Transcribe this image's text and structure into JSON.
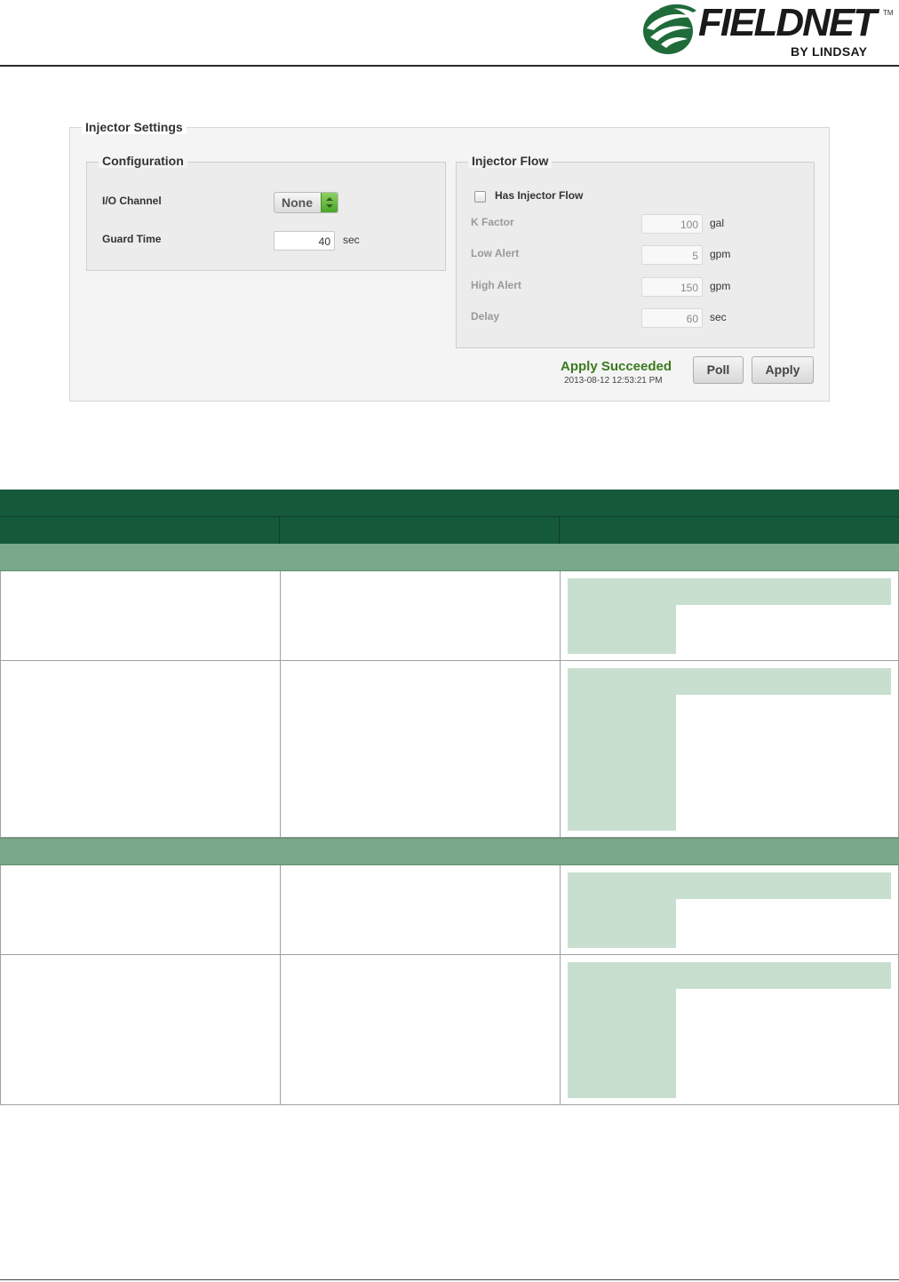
{
  "header": {
    "brand": "FIELDNET",
    "trademark": "TM",
    "sub_brand": "BY LINDSAY",
    "logo_colors": {
      "green": "#1f6b3a",
      "text": "#1a1a1a"
    }
  },
  "injector_settings": {
    "title": "Injector Settings",
    "configuration": {
      "title": "Configuration",
      "io_channel_label": "I/O Channel",
      "io_channel_value": "None",
      "guard_time_label": "Guard Time",
      "guard_time_value": "40",
      "guard_time_unit": "sec"
    },
    "injector_flow": {
      "title": "Injector Flow",
      "has_flow_label": "Has Injector Flow",
      "has_flow_checked": false,
      "fields": [
        {
          "label": "K Factor",
          "value": "100",
          "unit": "gal"
        },
        {
          "label": "Low Alert",
          "value": "5",
          "unit": "gpm"
        },
        {
          "label": "High Alert",
          "value": "150",
          "unit": "gpm"
        },
        {
          "label": "Delay",
          "value": "60",
          "unit": "sec"
        }
      ]
    },
    "status": {
      "message": "Apply Succeeded",
      "timestamp": "2013-08-12 12:53:21 PM"
    },
    "buttons": {
      "poll": "Poll",
      "apply": "Apply"
    }
  },
  "table_colors": {
    "header_dark": "#15593b",
    "section_header": "#7aa98a",
    "placeholder": "#c8dfcf"
  }
}
